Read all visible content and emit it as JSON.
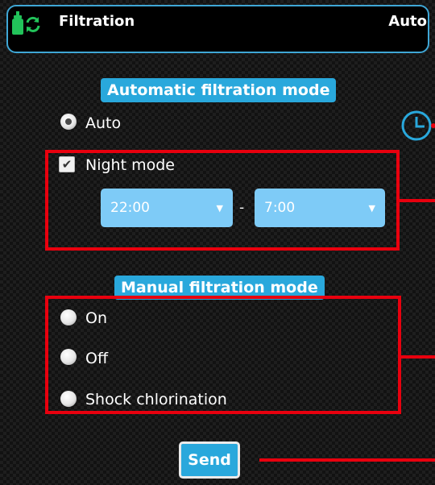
{
  "header": {
    "title": "Filtration",
    "mode": "Auto",
    "icon": "filtration-pump-icon"
  },
  "automatic": {
    "section_label": "Automatic filtration mode",
    "auto_label": "Auto",
    "auto_selected": true,
    "night_mode_label": "Night mode",
    "night_mode_checked": true,
    "start_time": "22:00",
    "separator": "-",
    "end_time": "7:00",
    "icon": "clock-icon"
  },
  "manual": {
    "section_label": "Manual filtration mode",
    "options": [
      {
        "label": "On",
        "selected": false
      },
      {
        "label": "Off",
        "selected": false
      },
      {
        "label": "Shock chlorination",
        "selected": false
      }
    ]
  },
  "actions": {
    "send_label": "Send"
  },
  "colors": {
    "accent": "#29a8dc",
    "select_bg": "#7ecbf7",
    "annotation_red": "#e8000e",
    "icon_green": "#22c35a",
    "header_border": "#3fa7d6"
  }
}
